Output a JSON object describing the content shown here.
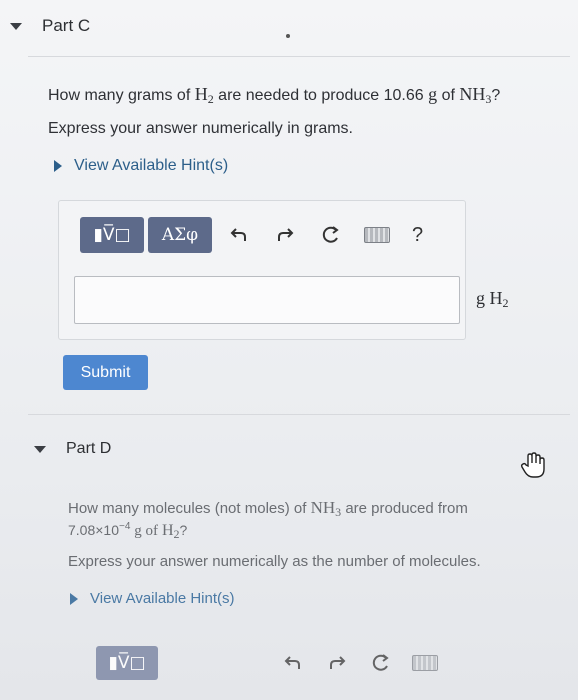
{
  "part_c": {
    "title": "Part C",
    "question_prefix": "How many grams of",
    "question_h2": "H",
    "question_h2_sub": "2",
    "question_mid": "are needed to produce 10.66",
    "question_g": "g",
    "question_of": "of",
    "question_nh3": "NH",
    "question_nh3_sub": "3",
    "question_suffix": "?",
    "instruction": "Express your answer numerically in grams.",
    "hint_label": "View Available Hint(s)",
    "toolbar": {
      "template_label": "▮V̅□",
      "greek_label": "ΑΣφ",
      "help_label": "?"
    },
    "answer_value": "",
    "unit_g": "g",
    "unit_h": "H",
    "unit_sub": "2",
    "submit_label": "Submit"
  },
  "part_d": {
    "title": "Part D",
    "question_line1_prefix": "How many molecules (not moles) of",
    "question_nh3": "NH",
    "question_nh3_sub": "3",
    "question_line1_suffix": "are produced from",
    "question_line2_num": "7.08×10",
    "question_line2_exp": "−4",
    "question_line2_g": "g of",
    "question_h2": "H",
    "question_h2_sub": "2",
    "question_line2_suffix": "?",
    "instruction": "Express your answer numerically as the number of molecules.",
    "hint_label": "View Available Hint(s)"
  },
  "colors": {
    "accent": "#5d6a8a",
    "submit": "#4d87d0",
    "hint": "#2c5f8a"
  },
  "icons": [
    "caret-down-icon",
    "undo-icon",
    "redo-icon",
    "reset-icon",
    "keyboard-icon",
    "help-icon",
    "pointer-hand-icon"
  ]
}
